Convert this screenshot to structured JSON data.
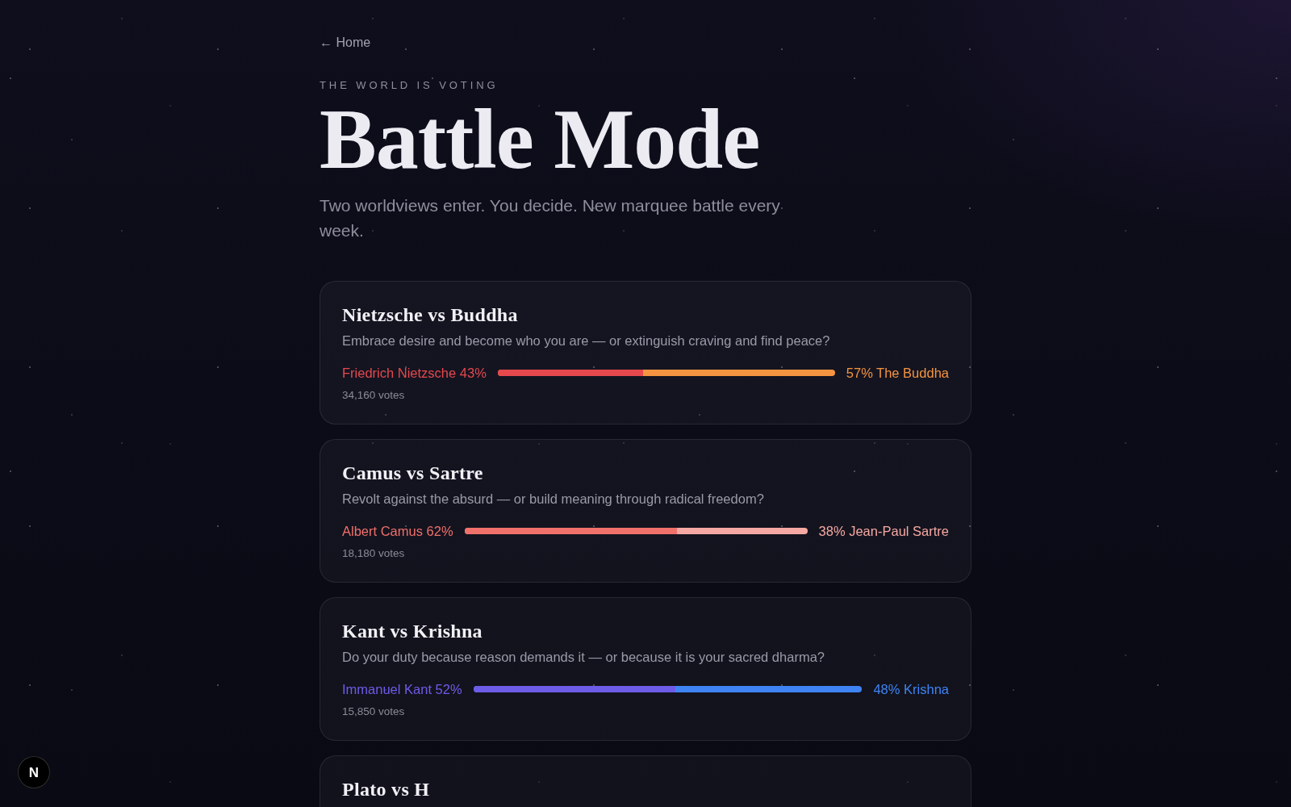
{
  "back_link": "← Home",
  "eyebrow": "THE WORLD IS VOTING",
  "title": "Battle Mode",
  "subtitle": "Two worldviews enter. You decide. New marquee battle every week.",
  "battles": [
    {
      "title": "Nietzsche vs Buddha",
      "question": "Embrace desire and become who you are — or extinguish craving and find peace?",
      "left": {
        "label": "Friedrich Nietzsche 43%",
        "color": "#e5484d"
      },
      "right": {
        "label": "57% The Buddha",
        "color": "#f59440"
      },
      "level": 0.43,
      "votes": "34,160 votes"
    },
    {
      "title": "Camus vs Sartre",
      "question": "Revolt against the absurd — or build meaning through radical freedom?",
      "left": {
        "label": "Albert Camus 62%",
        "color": "#f0706a"
      },
      "right": {
        "label": "38% Jean-Paul Sartre",
        "color": "#f6a9a3"
      },
      "level": 0.62,
      "votes": "18,180 votes"
    },
    {
      "title": "Kant vs Krishna",
      "question": "Do your duty because reason demands it — or because it is your sacred dharma?",
      "left": {
        "label": "Immanuel Kant 52%",
        "color": "#6d5ce8"
      },
      "right": {
        "label": "48% Krishna",
        "color": "#3f84f4"
      },
      "level": 0.52,
      "votes": "15,850 votes"
    },
    {
      "title": "Plato vs H"
    }
  ],
  "dev_badge": "N"
}
